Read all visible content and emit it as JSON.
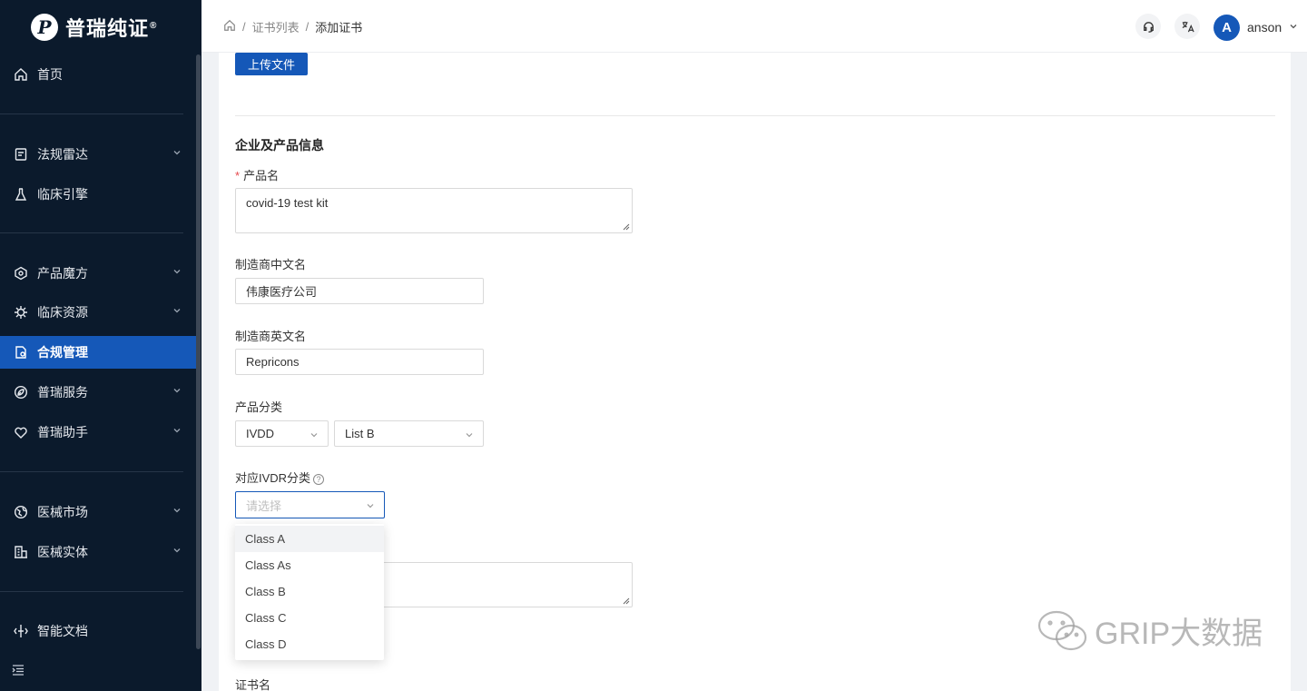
{
  "brand": {
    "name": "普瑞纯证",
    "reg": "®",
    "mark": "P"
  },
  "sidebar": {
    "items": [
      {
        "label": "首页",
        "icon": "home-icon",
        "chevron": false
      },
      {
        "label": "法规雷达",
        "icon": "regulation-radar-icon",
        "chevron": true
      },
      {
        "label": "临床引擎",
        "icon": "flask-icon",
        "chevron": false
      },
      {
        "label": "产品魔方",
        "icon": "cube-icon",
        "chevron": true
      },
      {
        "label": "临床资源",
        "icon": "virus-icon",
        "chevron": true
      },
      {
        "label": "合规管理",
        "icon": "compliance-doc-icon",
        "chevron": false,
        "active": true
      },
      {
        "label": "普瑞服务",
        "icon": "leaf-icon",
        "chevron": true
      },
      {
        "label": "普瑞助手",
        "icon": "heart-hand-icon",
        "chevron": true
      },
      {
        "label": "医械市场",
        "icon": "globe-icon",
        "chevron": true
      },
      {
        "label": "医械实体",
        "icon": "building-icon",
        "chevron": true
      },
      {
        "label": "智能文档",
        "icon": "smart-doc-icon",
        "chevron": false
      }
    ]
  },
  "header": {
    "breadcrumb": [
      "证书列表",
      "添加证书"
    ],
    "user": {
      "initial": "A",
      "name": "anson"
    }
  },
  "form": {
    "upload_label": "上传文件",
    "section_title": "企业及产品信息",
    "product_name": {
      "label": "产品名",
      "required": "*",
      "value": "covid-19 test kit"
    },
    "manufacturer_cn": {
      "label": "制造商中文名",
      "value": "伟康医疗公司"
    },
    "manufacturer_en": {
      "label": "制造商英文名",
      "value": "Repricons"
    },
    "category": {
      "label": "产品分类",
      "select1": "IVDD",
      "select2": "List B"
    },
    "ivdr": {
      "label": "对应IVDR分类",
      "help": "?",
      "placeholder": "请选择"
    },
    "cert_name_label": "证书名"
  },
  "dropdown": {
    "options": [
      "Class A",
      "Class As",
      "Class B",
      "Class C",
      "Class D"
    ],
    "hovered": 0
  },
  "watermark": "GRIP大数据",
  "colors": {
    "sidebar": "#0b1a2c",
    "primary": "#1558b8"
  }
}
